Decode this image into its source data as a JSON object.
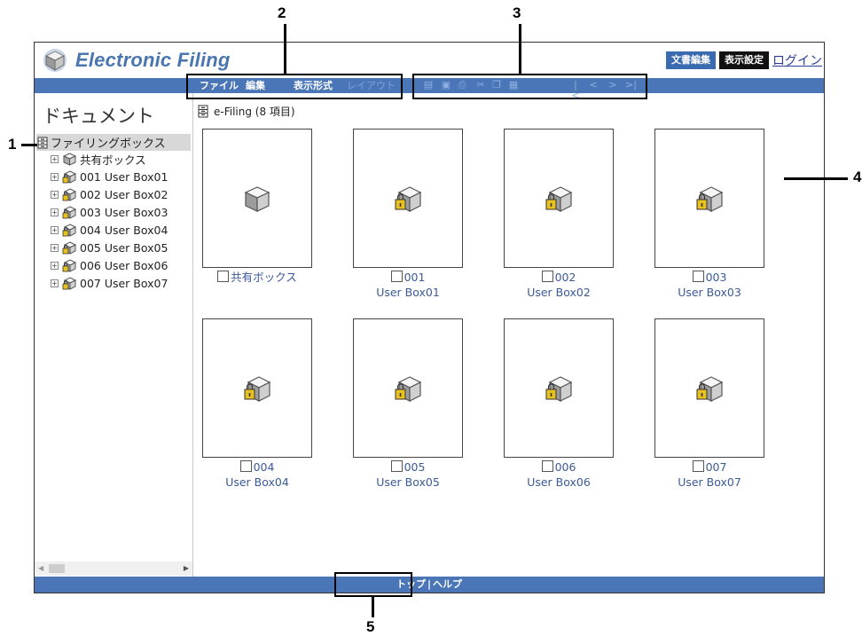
{
  "header": {
    "brand": "Electronic Filing",
    "btn_doc_edit": "文書編集",
    "btn_display": "表示設定",
    "login": "ログイン"
  },
  "menu": {
    "file": "ファイル",
    "edit": "編集",
    "view": "表示形式",
    "layout": "レイアウト"
  },
  "toolbar_icons": [
    "properties-icon",
    "save-icon",
    "print-icon",
    "cut-icon",
    "copy-icon",
    "paste-icon",
    "first-page-icon",
    "prev-page-icon",
    "next-page-icon",
    "last-page-icon"
  ],
  "sidebar": {
    "title": "ドキュメント",
    "root": "ファイリングボックス",
    "items": [
      {
        "label": "共有ボックス"
      },
      {
        "label": "001 User Box01"
      },
      {
        "label": "002 User Box02"
      },
      {
        "label": "003 User Box03"
      },
      {
        "label": "004 User Box04"
      },
      {
        "label": "005 User Box05"
      },
      {
        "label": "006 User Box06"
      },
      {
        "label": "007 User Box07"
      }
    ]
  },
  "main": {
    "breadcrumb": "e-Filing (8 項目)",
    "boxes": [
      {
        "line1": "共有ボックス",
        "line2": ""
      },
      {
        "line1": "001",
        "line2": "User Box01"
      },
      {
        "line1": "002",
        "line2": "User Box02"
      },
      {
        "line1": "003",
        "line2": "User Box03"
      },
      {
        "line1": "004",
        "line2": "User Box04"
      },
      {
        "line1": "005",
        "line2": "User Box05"
      },
      {
        "line1": "006",
        "line2": "User Box06"
      },
      {
        "line1": "007",
        "line2": "User Box07"
      }
    ]
  },
  "footer": {
    "top": "トップ",
    "sep": "|",
    "help": "ヘルプ"
  },
  "callouts": [
    "1",
    "2",
    "3",
    "4",
    "5"
  ],
  "colors": {
    "bar": "#4a76b8",
    "brand": "#4a76b0",
    "link": "#3a5a9a"
  }
}
